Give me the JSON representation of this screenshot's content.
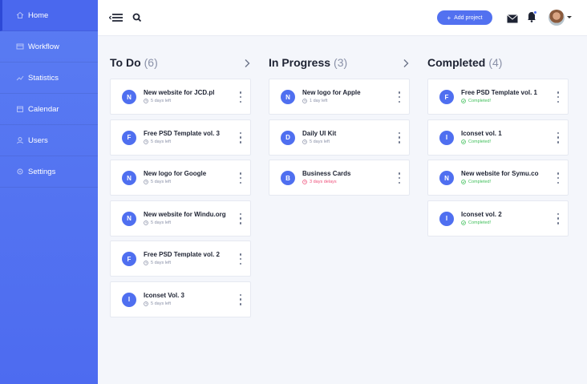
{
  "sidebar": {
    "items": [
      {
        "label": "Home",
        "icon": "home-icon"
      },
      {
        "label": "Workflow",
        "icon": "workflow-icon"
      },
      {
        "label": "Statistics",
        "icon": "statistics-icon"
      },
      {
        "label": "Calendar",
        "icon": "calendar-icon"
      },
      {
        "label": "Users",
        "icon": "users-icon"
      },
      {
        "label": "Settings",
        "icon": "settings-icon"
      }
    ]
  },
  "topbar": {
    "add_project_label": "Add project",
    "add_project_icon": "plus-icon"
  },
  "colors": {
    "accent": "#4f6ff0",
    "sidebar": "#5574f1",
    "late": "#ef4f7a",
    "completed": "#3fbf5a"
  },
  "columns": [
    {
      "title": "To Do",
      "count": "(6)",
      "cards": [
        {
          "initial": "N",
          "title": "New website for JCD.pl",
          "meta": "5 days left",
          "status": "time"
        },
        {
          "initial": "F",
          "title": "Free PSD Template vol. 3",
          "meta": "5 days left",
          "status": "time"
        },
        {
          "initial": "N",
          "title": "New logo for Google",
          "meta": "5 days left",
          "status": "time"
        },
        {
          "initial": "N",
          "title": "New website for Windu.org",
          "meta": "5 days left",
          "status": "time"
        },
        {
          "initial": "F",
          "title": "Free PSD Template vol. 2",
          "meta": "5 days left",
          "status": "time"
        },
        {
          "initial": "I",
          "title": "Iconset Vol. 3",
          "meta": "5 days left",
          "status": "time"
        }
      ]
    },
    {
      "title": "In Progress",
      "count": "(3)",
      "cards": [
        {
          "initial": "N",
          "title": "New logo for Apple",
          "meta": "1 day left",
          "status": "time"
        },
        {
          "initial": "D",
          "title": "Daily UI Kit",
          "meta": "5 days left",
          "status": "time"
        },
        {
          "initial": "B",
          "title": "Business Cards",
          "meta": "3 days delays",
          "status": "late"
        }
      ]
    },
    {
      "title": "Completed",
      "count": "(4)",
      "cards": [
        {
          "initial": "F",
          "title": "Free PSD Template vol. 1",
          "meta": "Completed!",
          "status": "done"
        },
        {
          "initial": "I",
          "title": "Iconset vol. 1",
          "meta": "Completed!",
          "status": "done"
        },
        {
          "initial": "N",
          "title": "New website for Symu.co",
          "meta": "Completed!",
          "status": "done"
        },
        {
          "initial": "I",
          "title": "Iconset vol. 2",
          "meta": "Completed!",
          "status": "done"
        }
      ]
    }
  ]
}
